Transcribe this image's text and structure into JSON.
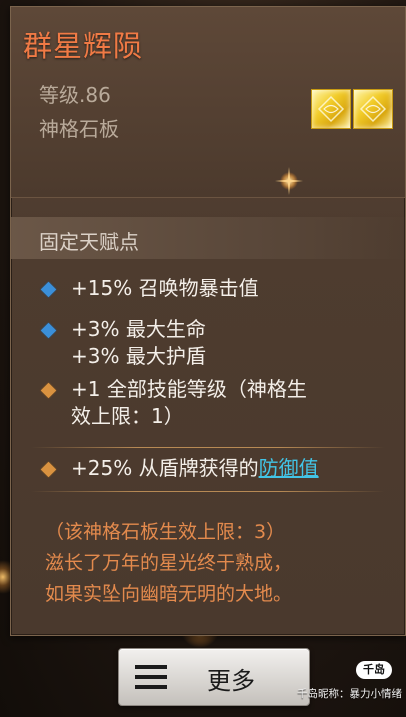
{
  "item": {
    "name": "群星辉陨",
    "level": "等级.86",
    "type": "神格石板"
  },
  "section": {
    "title": "固定天赋点"
  },
  "talents": [
    {
      "bullet": "blue",
      "lines": [
        "+15% 召唤物暴击值"
      ]
    },
    {
      "bullet": "blue",
      "lines": [
        "+3% 最大生命",
        "+3% 最大护盾"
      ]
    },
    {
      "bullet": "gold",
      "lines": [
        "+1 全部技能等级（神格生",
        "效上限：1）"
      ]
    },
    {
      "bullet": "gold",
      "prefix": "+25% 从盾牌获得的",
      "link": "防御值"
    }
  ],
  "flavor": {
    "lines": [
      "（该神格石板生效上限：3）",
      "滋长了万年的星光终于熟成，",
      "如果实坠向幽暗无明的大地。"
    ]
  },
  "actions": {
    "more_label": "更多"
  },
  "watermark": {
    "badge": "千岛",
    "text": "千岛昵称：暴力小情绪"
  },
  "colors": {
    "title": "#f07a45",
    "flavor": "#e38a4d",
    "link": "#42c4e6",
    "bullet_blue": "#3b8fd9",
    "bullet_gold": "#d99240"
  }
}
